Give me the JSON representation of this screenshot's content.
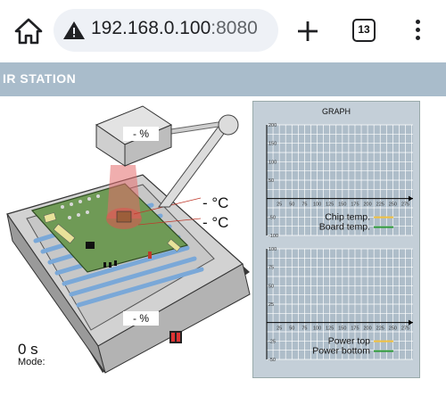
{
  "browser": {
    "url_host": "192.168.0.100",
    "url_port": ":8080",
    "tab_count": "13",
    "icons": [
      "home-icon",
      "warning-icon",
      "plus-icon",
      "tabs-icon",
      "more-vert-icon"
    ]
  },
  "app": {
    "title": "IR STATION"
  },
  "station": {
    "top_heater_percent": "- %",
    "bottom_heater_percent": "- %",
    "chip_temp": "- °C",
    "board_temp": "- °C",
    "timer": "0 s",
    "mode_label": "Mode:"
  },
  "graph": {
    "title": "GRAPH",
    "colors": {
      "yellow": "#f2c240",
      "green": "#2e9a3a",
      "grid": "#ffffff",
      "axis": "#000000"
    }
  },
  "chart_data": [
    {
      "type": "line",
      "x_ticks": [
        25,
        50,
        75,
        100,
        125,
        150,
        175,
        200,
        225,
        250,
        275
      ],
      "y_ticks": [
        200,
        150,
        100,
        50,
        -50,
        -100
      ],
      "ylim": [
        -100,
        200
      ],
      "series": [
        {
          "name": "Chip temp.",
          "color": "#f2c240",
          "values": []
        },
        {
          "name": "Board temp.",
          "color": "#2e9a3a",
          "values": []
        }
      ],
      "legend": "bottom-right"
    },
    {
      "type": "line",
      "x_ticks": [
        25,
        50,
        75,
        100,
        125,
        150,
        175,
        200,
        225,
        250,
        275
      ],
      "y_ticks": [
        100,
        75,
        50,
        25,
        -25,
        -50
      ],
      "ylim": [
        -50,
        100
      ],
      "series": [
        {
          "name": "Power top",
          "color": "#f2c240",
          "values": []
        },
        {
          "name": "Power bottom",
          "color": "#2e9a3a",
          "values": []
        }
      ],
      "legend": "bottom-right"
    }
  ]
}
